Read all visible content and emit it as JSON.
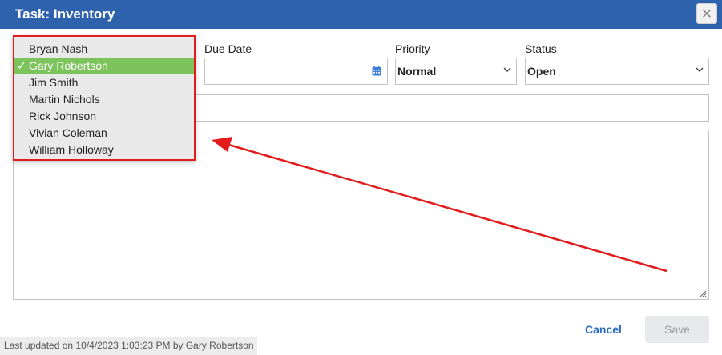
{
  "dialog": {
    "title": "Task: Inventory",
    "close_icon": "close-icon"
  },
  "fields": {
    "due_date_label": "Due Date",
    "priority_label": "Priority",
    "priority_value": "Normal",
    "status_label": "Status",
    "status_value": "Open"
  },
  "assignee_dropdown": {
    "items": [
      {
        "label": "Bryan Nash",
        "selected": false
      },
      {
        "label": "Gary Robertson",
        "selected": true
      },
      {
        "label": "Jim Smith",
        "selected": false
      },
      {
        "label": "Martin Nichols",
        "selected": false
      },
      {
        "label": "Rick Johnson",
        "selected": false
      },
      {
        "label": "Vivian Coleman",
        "selected": false
      },
      {
        "label": "William Holloway",
        "selected": false
      }
    ],
    "check_mark": "✓",
    "highlight_color": "#e21c1c",
    "selected_color": "#7cc35c"
  },
  "footer": {
    "last_updated": "Last updated on 10/4/2023 1:03:23 PM by Gary Robertson",
    "cancel_label": "Cancel",
    "save_label": "Save"
  },
  "colors": {
    "titlebar": "#2f62ad",
    "accent_link": "#2a6cc4",
    "annotation": "#e21c1c"
  }
}
